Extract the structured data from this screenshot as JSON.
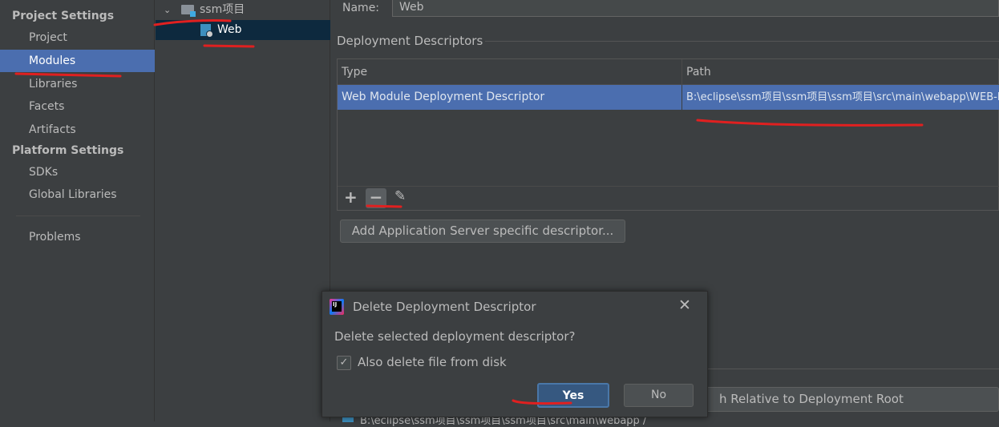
{
  "sidebar": {
    "project_settings": "Project Settings",
    "items1": [
      "Project",
      "Modules",
      "Libraries",
      "Facets",
      "Artifacts"
    ],
    "platform_settings": "Platform Settings",
    "items2": [
      "SDKs",
      "Global Libraries"
    ],
    "problems": "Problems",
    "selected": "Modules"
  },
  "tree": {
    "root": "ssm项目",
    "child": "Web"
  },
  "main": {
    "name_label": "Name:",
    "name_value": "Web",
    "section": "Deployment Descriptors",
    "columns": [
      "Type",
      "Path"
    ],
    "rows": [
      {
        "type": "Web Module Deployment Descriptor",
        "path": "B:\\eclipse\\ssm项目\\ssm项目\\ssm项目\\src\\main\\webapp\\WEB-INF\\web.xml"
      }
    ],
    "add_server_button": "Add Application Server specific descriptor...",
    "bottom_button_text": "h Relative to Deployment Root",
    "bottom_path": "B:\\eclipse\\ssm项目\\ssm项目\\ssm项目\\src\\main\\webapp /"
  },
  "dialog": {
    "title": "Delete Deployment Descriptor",
    "message": "Delete selected deployment descriptor?",
    "checkbox_label": "Also delete file from disk",
    "checkbox_checked": true,
    "yes": "Yes",
    "no": "No"
  },
  "colors": {
    "selection": "#4b6eaf",
    "tree_selection": "#0d293e",
    "annotation": "#e02020"
  }
}
